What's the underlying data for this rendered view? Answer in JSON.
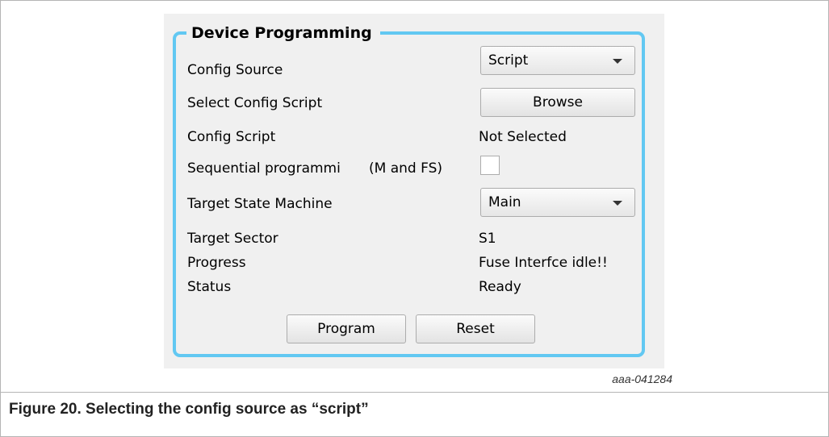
{
  "panel": {
    "title": "Device Programming",
    "rows": {
      "config_source": {
        "label": "Config Source",
        "value": "Script"
      },
      "select_script": {
        "label": "Select Config Script",
        "button": "Browse"
      },
      "config_script": {
        "label": "Config Script",
        "value": "Not Selected"
      },
      "sequential": {
        "label": "Sequential programmi",
        "suffix": "(M and FS)",
        "checked": false
      },
      "target_state_machine": {
        "label": "Target State Machine",
        "value": "Main"
      },
      "target_sector": {
        "label": "Target Sector",
        "value": "S1"
      },
      "progress": {
        "label": "Progress",
        "value": "Fuse Interfce idle!!"
      },
      "status": {
        "label": "Status",
        "value": "Ready"
      }
    },
    "buttons": {
      "program": "Program",
      "reset": "Reset"
    }
  },
  "figure": {
    "id": "aaa-041284",
    "caption": "Figure 20.  Selecting the config source as “script”"
  },
  "colors": {
    "group_border": "#62c8f2",
    "panel_bg": "#f0f0f0"
  },
  "icons": {
    "combo_arrow": "chevron-down-icon"
  }
}
